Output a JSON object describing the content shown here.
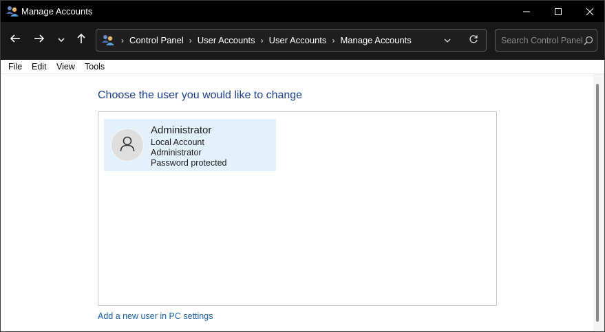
{
  "window": {
    "title": "Manage Accounts",
    "icon": "users-icon"
  },
  "titlebar_buttons": {
    "minimize": "minimize-icon",
    "maximize": "maximize-icon",
    "close": "close-icon"
  },
  "navigation": {
    "back": "back-arrow-icon",
    "forward": "forward-arrow-icon",
    "recent": "chevron-down-icon",
    "up": "up-arrow-icon"
  },
  "address_bar": {
    "icon": "users-icon",
    "breadcrumbs": [
      {
        "label": "Control Panel"
      },
      {
        "label": "User Accounts"
      },
      {
        "label": "User Accounts"
      },
      {
        "label": "Manage Accounts"
      }
    ],
    "dropdown_icon": "chevron-down-icon",
    "refresh_icon": "refresh-icon"
  },
  "search": {
    "placeholder": "Search Control Panel",
    "value": "",
    "icon": "search-icon"
  },
  "menu": {
    "items": [
      {
        "label": "File"
      },
      {
        "label": "Edit"
      },
      {
        "label": "View"
      },
      {
        "label": "Tools"
      }
    ]
  },
  "main": {
    "heading": "Choose the user you would like to change",
    "accounts": [
      {
        "name": "Administrator",
        "type": "Local Account",
        "role": "Administrator",
        "status": "Password protected",
        "avatar_icon": "user-icon"
      }
    ],
    "add_user_link": "Add a new user in PC settings"
  },
  "colors": {
    "titlebar_bg": "#000000",
    "navbar_bg": "#191919",
    "heading": "#1a3e8c",
    "link": "#1a5ea8",
    "account_tile_bg": "#e3f1fc"
  }
}
